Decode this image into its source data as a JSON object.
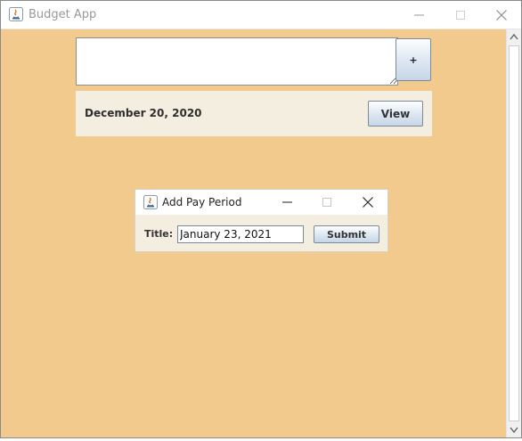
{
  "window": {
    "title": "Budget App"
  },
  "toolbar": {
    "input_value": "",
    "add_label": "+"
  },
  "pay_periods": [
    {
      "date": "December 20, 2020",
      "view_label": "View"
    }
  ],
  "dialog": {
    "title": "Add Pay Period",
    "field_label": "Title:",
    "field_value": "January 23, 2021",
    "submit_label": "Submit"
  },
  "icons": {
    "app": "java-app-icon",
    "minimize": "minimize-icon",
    "maximize": "maximize-icon",
    "close": "close-icon"
  },
  "colors": {
    "background": "#f2ca8e",
    "panel": "#f4eee0"
  }
}
